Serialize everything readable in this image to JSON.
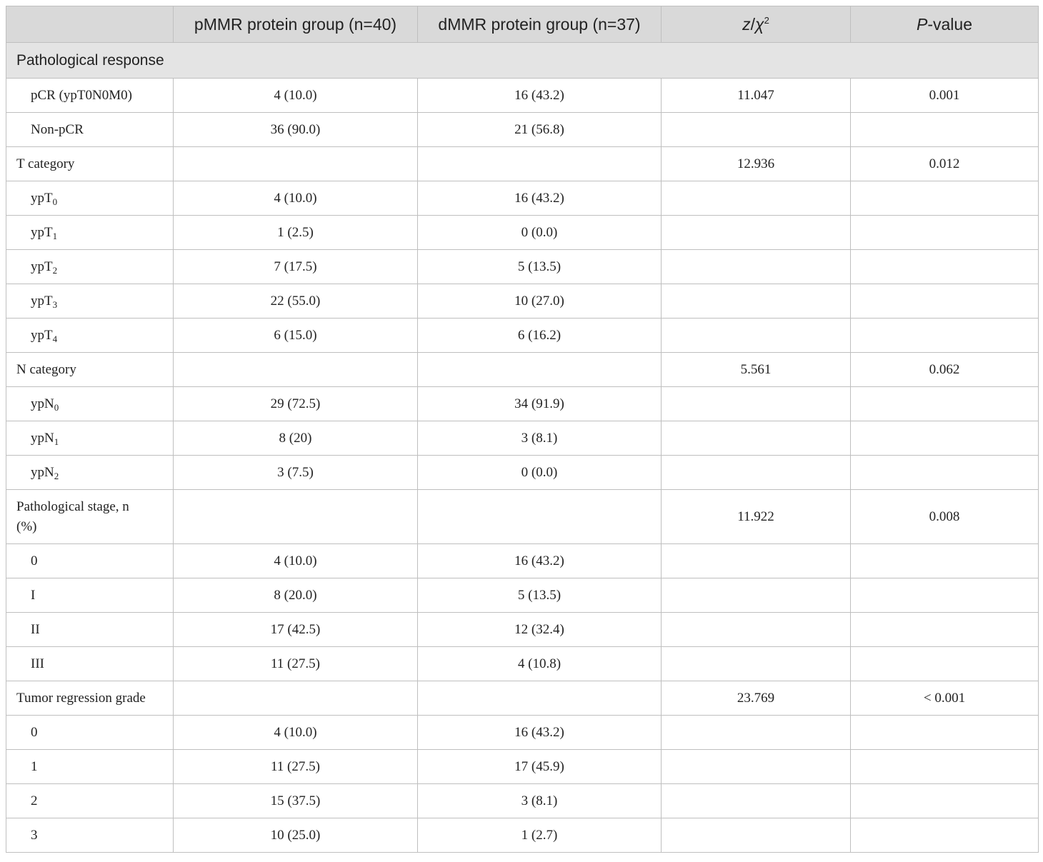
{
  "header": {
    "col0": "",
    "col1": "pMMR protein group (n=40)",
    "col2": "dMMR protein group (n=37)",
    "col3_z": "z",
    "col3_sep": "/",
    "col3_chi": "χ",
    "col3_sup": "2",
    "col4_p": "P",
    "col4_rest": "-value"
  },
  "section_label": "Pathological response",
  "rows": [
    {
      "label": "pCR (ypT0N0M0)",
      "pmmr": "4 (10.0)",
      "dmmr": "16 (43.2)",
      "stat": "11.047",
      "p": "0.001"
    },
    {
      "label": "Non-pCR",
      "pmmr": "36 (90.0)",
      "dmmr": "21 (56.8)",
      "stat": "",
      "p": ""
    },
    {
      "label": "T category",
      "pmmr": "",
      "dmmr": "",
      "stat": "12.936",
      "p": "0.012"
    },
    {
      "label": "ypT",
      "sub": "0",
      "pmmr": "4 (10.0)",
      "dmmr": "16 (43.2)",
      "stat": "",
      "p": ""
    },
    {
      "label": "ypT",
      "sub": "1",
      "pmmr": "1 (2.5)",
      "dmmr": "0 (0.0)",
      "stat": "",
      "p": ""
    },
    {
      "label": "ypT",
      "sub": "2",
      "pmmr": "7 (17.5)",
      "dmmr": "5 (13.5)",
      "stat": "",
      "p": ""
    },
    {
      "label": "ypT",
      "sub": "3",
      "pmmr": "22 (55.0)",
      "dmmr": "10 (27.0)",
      "stat": "",
      "p": ""
    },
    {
      "label": "ypT",
      "sub": "4",
      "pmmr": "6 (15.0)",
      "dmmr": "6 (16.2)",
      "stat": "",
      "p": ""
    },
    {
      "label": "N category",
      "pmmr": "",
      "dmmr": "",
      "stat": "5.561",
      "p": "0.062"
    },
    {
      "label": "ypN",
      "sub": "0",
      "pmmr": "29 (72.5)",
      "dmmr": "34 (91.9)",
      "stat": "",
      "p": ""
    },
    {
      "label": "ypN",
      "sub": "1",
      "pmmr": "8 (20)",
      "dmmr": "3 (8.1)",
      "stat": "",
      "p": ""
    },
    {
      "label": "ypN",
      "sub": "2",
      "pmmr": "3 (7.5)",
      "dmmr": "0 (0.0)",
      "stat": "",
      "p": ""
    },
    {
      "label": "Pathological stage, n",
      "label2": "(%)",
      "pmmr": "",
      "dmmr": "",
      "stat": "11.922",
      "p": "0.008"
    },
    {
      "label": "0",
      "pmmr": "4 (10.0)",
      "dmmr": "16 (43.2)",
      "stat": "",
      "p": ""
    },
    {
      "label": "I",
      "pmmr": "8 (20.0)",
      "dmmr": "5 (13.5)",
      "stat": "",
      "p": ""
    },
    {
      "label": "II",
      "pmmr": "17 (42.5)",
      "dmmr": "12 (32.4)",
      "stat": "",
      "p": ""
    },
    {
      "label": "III",
      "pmmr": "11 (27.5)",
      "dmmr": "4 (10.8)",
      "stat": "",
      "p": ""
    },
    {
      "label": "Tumor regression grade",
      "pmmr": "",
      "dmmr": "",
      "stat": "23.769",
      "p": "< 0.001"
    },
    {
      "label": "0",
      "pmmr": "4 (10.0)",
      "dmmr": "16 (43.2)",
      "stat": "",
      "p": ""
    },
    {
      "label": "1",
      "pmmr": "11 (27.5)",
      "dmmr": "17 (45.9)",
      "stat": "",
      "p": ""
    },
    {
      "label": "2",
      "pmmr": "15 (37.5)",
      "dmmr": "3 (8.1)",
      "stat": "",
      "p": ""
    },
    {
      "label": "3",
      "pmmr": "10 (25.0)",
      "dmmr": "1 (2.7)",
      "stat": "",
      "p": ""
    }
  ]
}
